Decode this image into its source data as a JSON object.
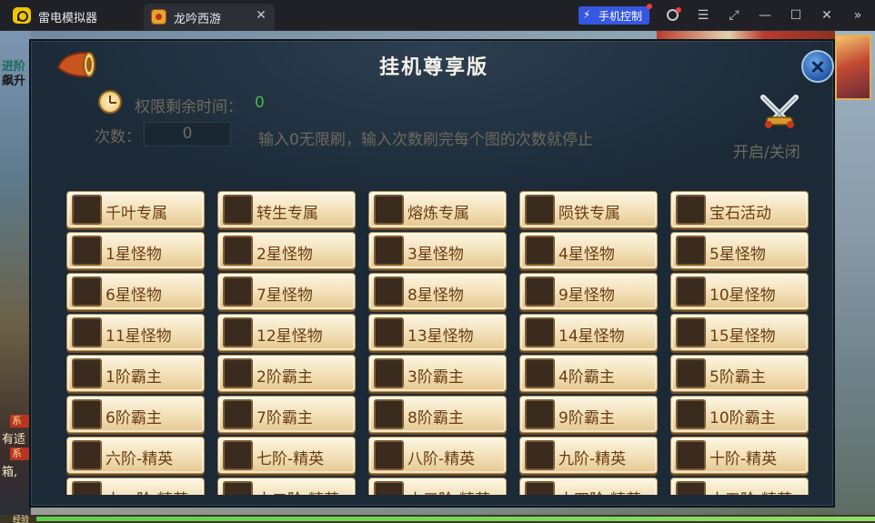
{
  "app": {
    "name": "雷电模拟器"
  },
  "tab": {
    "title": "龙吟西游",
    "close": "✕"
  },
  "toolbar": {
    "phone_control": "手机控制",
    "bolt": "⚡",
    "menu": "☰",
    "resize": "⤢",
    "minimize": "—",
    "maximize": "☐",
    "close": "✕",
    "expand": "»"
  },
  "game": {
    "left_texts": [
      "进阶",
      "飙升",
      "有适",
      "箱,"
    ],
    "left_tags": [
      "系",
      "系"
    ],
    "bottom_exp_label": "经验"
  },
  "dialog": {
    "title": "挂机尊享版",
    "time_label": "权限剩余时间：",
    "time_value": "0",
    "count_label": "次数：",
    "count_value": "0",
    "count_hint": "输入0无限刷，输入次数刷完每个图的次数就停止",
    "toggle_label": "开启/关闭",
    "options": [
      "千叶专属",
      "转生专属",
      "熔炼专属",
      "陨铁专属",
      "宝石活动",
      "1星怪物",
      "2星怪物",
      "3星怪物",
      "4星怪物",
      "5星怪物",
      "6星怪物",
      "7星怪物",
      "8星怪物",
      "9星怪物",
      "10星怪物",
      "11星怪物",
      "12星怪物",
      "13星怪物",
      "14星怪物",
      "15星怪物",
      "1阶霸主",
      "2阶霸主",
      "3阶霸主",
      "4阶霸主",
      "5阶霸主",
      "6阶霸主",
      "7阶霸主",
      "8阶霸主",
      "9阶霸主",
      "10阶霸主",
      "六阶-精英",
      "七阶-精英",
      "八阶-精英",
      "九阶-精英",
      "十阶-精英",
      "十一阶-精英",
      "十二阶-精英",
      "十三阶-精英",
      "十四阶-精英",
      "十五阶-精英"
    ]
  },
  "colors": {
    "accent_blue": "#3657e0",
    "time_value_green": "#48b64a",
    "item_text": "#6a3d12"
  }
}
